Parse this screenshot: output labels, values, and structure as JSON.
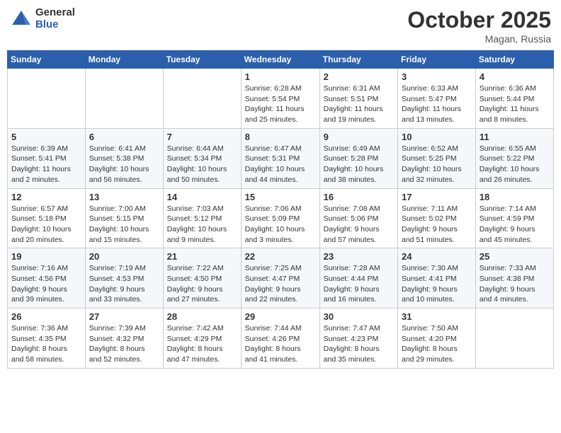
{
  "header": {
    "logo_general": "General",
    "logo_blue": "Blue",
    "month": "October 2025",
    "location": "Magan, Russia"
  },
  "days_of_week": [
    "Sunday",
    "Monday",
    "Tuesday",
    "Wednesday",
    "Thursday",
    "Friday",
    "Saturday"
  ],
  "weeks": [
    [
      {
        "day": "",
        "info": ""
      },
      {
        "day": "",
        "info": ""
      },
      {
        "day": "",
        "info": ""
      },
      {
        "day": "1",
        "info": "Sunrise: 6:28 AM\nSunset: 5:54 PM\nDaylight: 11 hours\nand 25 minutes."
      },
      {
        "day": "2",
        "info": "Sunrise: 6:31 AM\nSunset: 5:51 PM\nDaylight: 11 hours\nand 19 minutes."
      },
      {
        "day": "3",
        "info": "Sunrise: 6:33 AM\nSunset: 5:47 PM\nDaylight: 11 hours\nand 13 minutes."
      },
      {
        "day": "4",
        "info": "Sunrise: 6:36 AM\nSunset: 5:44 PM\nDaylight: 11 hours\nand 8 minutes."
      }
    ],
    [
      {
        "day": "5",
        "info": "Sunrise: 6:39 AM\nSunset: 5:41 PM\nDaylight: 11 hours\nand 2 minutes."
      },
      {
        "day": "6",
        "info": "Sunrise: 6:41 AM\nSunset: 5:38 PM\nDaylight: 10 hours\nand 56 minutes."
      },
      {
        "day": "7",
        "info": "Sunrise: 6:44 AM\nSunset: 5:34 PM\nDaylight: 10 hours\nand 50 minutes."
      },
      {
        "day": "8",
        "info": "Sunrise: 6:47 AM\nSunset: 5:31 PM\nDaylight: 10 hours\nand 44 minutes."
      },
      {
        "day": "9",
        "info": "Sunrise: 6:49 AM\nSunset: 5:28 PM\nDaylight: 10 hours\nand 38 minutes."
      },
      {
        "day": "10",
        "info": "Sunrise: 6:52 AM\nSunset: 5:25 PM\nDaylight: 10 hours\nand 32 minutes."
      },
      {
        "day": "11",
        "info": "Sunrise: 6:55 AM\nSunset: 5:22 PM\nDaylight: 10 hours\nand 26 minutes."
      }
    ],
    [
      {
        "day": "12",
        "info": "Sunrise: 6:57 AM\nSunset: 5:18 PM\nDaylight: 10 hours\nand 20 minutes."
      },
      {
        "day": "13",
        "info": "Sunrise: 7:00 AM\nSunset: 5:15 PM\nDaylight: 10 hours\nand 15 minutes."
      },
      {
        "day": "14",
        "info": "Sunrise: 7:03 AM\nSunset: 5:12 PM\nDaylight: 10 hours\nand 9 minutes."
      },
      {
        "day": "15",
        "info": "Sunrise: 7:06 AM\nSunset: 5:09 PM\nDaylight: 10 hours\nand 3 minutes."
      },
      {
        "day": "16",
        "info": "Sunrise: 7:08 AM\nSunset: 5:06 PM\nDaylight: 9 hours\nand 57 minutes."
      },
      {
        "day": "17",
        "info": "Sunrise: 7:11 AM\nSunset: 5:02 PM\nDaylight: 9 hours\nand 51 minutes."
      },
      {
        "day": "18",
        "info": "Sunrise: 7:14 AM\nSunset: 4:59 PM\nDaylight: 9 hours\nand 45 minutes."
      }
    ],
    [
      {
        "day": "19",
        "info": "Sunrise: 7:16 AM\nSunset: 4:56 PM\nDaylight: 9 hours\nand 39 minutes."
      },
      {
        "day": "20",
        "info": "Sunrise: 7:19 AM\nSunset: 4:53 PM\nDaylight: 9 hours\nand 33 minutes."
      },
      {
        "day": "21",
        "info": "Sunrise: 7:22 AM\nSunset: 4:50 PM\nDaylight: 9 hours\nand 27 minutes."
      },
      {
        "day": "22",
        "info": "Sunrise: 7:25 AM\nSunset: 4:47 PM\nDaylight: 9 hours\nand 22 minutes."
      },
      {
        "day": "23",
        "info": "Sunrise: 7:28 AM\nSunset: 4:44 PM\nDaylight: 9 hours\nand 16 minutes."
      },
      {
        "day": "24",
        "info": "Sunrise: 7:30 AM\nSunset: 4:41 PM\nDaylight: 9 hours\nand 10 minutes."
      },
      {
        "day": "25",
        "info": "Sunrise: 7:33 AM\nSunset: 4:38 PM\nDaylight: 9 hours\nand 4 minutes."
      }
    ],
    [
      {
        "day": "26",
        "info": "Sunrise: 7:36 AM\nSunset: 4:35 PM\nDaylight: 8 hours\nand 58 minutes."
      },
      {
        "day": "27",
        "info": "Sunrise: 7:39 AM\nSunset: 4:32 PM\nDaylight: 8 hours\nand 52 minutes."
      },
      {
        "day": "28",
        "info": "Sunrise: 7:42 AM\nSunset: 4:29 PM\nDaylight: 8 hours\nand 47 minutes."
      },
      {
        "day": "29",
        "info": "Sunrise: 7:44 AM\nSunset: 4:26 PM\nDaylight: 8 hours\nand 41 minutes."
      },
      {
        "day": "30",
        "info": "Sunrise: 7:47 AM\nSunset: 4:23 PM\nDaylight: 8 hours\nand 35 minutes."
      },
      {
        "day": "31",
        "info": "Sunrise: 7:50 AM\nSunset: 4:20 PM\nDaylight: 8 hours\nand 29 minutes."
      },
      {
        "day": "",
        "info": ""
      }
    ]
  ]
}
